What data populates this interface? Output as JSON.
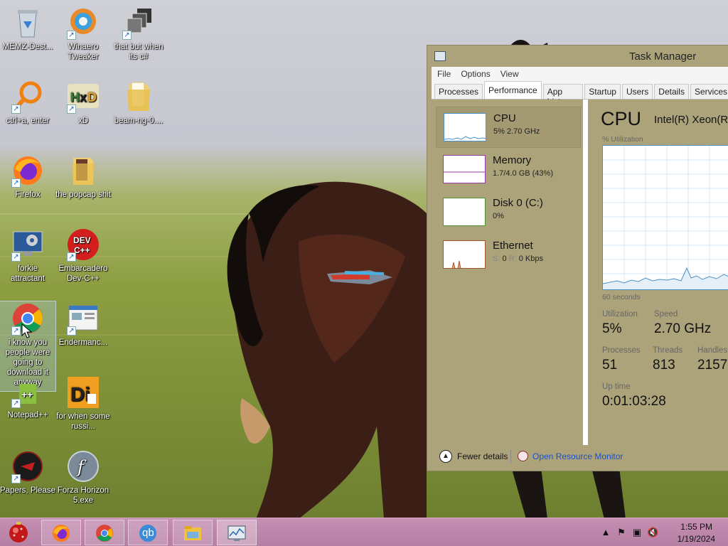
{
  "desktop": {
    "icons": [
      {
        "label": "MEMZ-Dest...",
        "icon": "recycle-bin-icon"
      },
      {
        "label": "Winaero Tweaker",
        "icon": "winaero-icon"
      },
      {
        "label": "that but when its c#",
        "icon": "stacked-windows-icon"
      },
      {
        "label": "ctrl+a, enter",
        "icon": "search-magnifier-icon"
      },
      {
        "label": "xD",
        "icon": "hxd-icon"
      },
      {
        "label": "beam-ng-0....",
        "icon": "folder-icon"
      },
      {
        "label": "Firefox",
        "icon": "firefox-icon"
      },
      {
        "label": "the popcap shit",
        "icon": "folder-icon"
      },
      {
        "label": "forkie attractant",
        "icon": "computer-gear-icon"
      },
      {
        "label": "Embarcadero Dev-C++",
        "icon": "devcpp-icon"
      },
      {
        "label": "i know you people were going to download it anyway",
        "icon": "chrome-icon"
      },
      {
        "label": "Endermanc...",
        "icon": "window-app-icon"
      },
      {
        "label": "Notepad++",
        "icon": "notepad-plus-icon"
      },
      {
        "label": "for when some russi...",
        "icon": "die-icon"
      },
      {
        "label": "Papers, Please",
        "icon": "papers-please-icon"
      },
      {
        "label": "Forza Horizon 5.exe",
        "icon": "flash-icon"
      }
    ]
  },
  "task_manager": {
    "title": "Task Manager",
    "menu": [
      "File",
      "Options",
      "View"
    ],
    "tabs": [
      "Processes",
      "Performance",
      "App history",
      "Startup",
      "Users",
      "Details",
      "Services"
    ],
    "active_tab": "Performance",
    "resources": [
      {
        "name": "CPU",
        "value": "5% 2.70 GHz",
        "color": "#4b90c5"
      },
      {
        "name": "Memory",
        "value": "1.7/4.0 GB (43%)",
        "color": "#9b3aa4"
      },
      {
        "name": "Disk 0 (C:)",
        "value": "0%",
        "color": "#4e9a2c"
      },
      {
        "name": "Ethernet",
        "value_send": "S:",
        "value_zero": "0",
        "value_recv": "R:",
        "value_rate": "0 Kbps",
        "color": "#a7582a"
      }
    ],
    "detail": {
      "heading": "CPU",
      "model": "Intel(R) Xeon(R)",
      "util_label": "% Utilization",
      "graph_span": "60 seconds",
      "utilization_label": "Utilization",
      "utilization": "5%",
      "speed_label": "Speed",
      "speed": "2.70 GHz",
      "processes_label": "Processes",
      "processes": "51",
      "threads_label": "Threads",
      "threads": "813",
      "handles_label": "Handles",
      "handles": "2157",
      "uptime_label": "Up time",
      "uptime": "0:01:03:28"
    },
    "footer": {
      "fewer_details": "Fewer details",
      "resource_monitor": "Open Resource Monitor"
    }
  },
  "taskbar": {
    "pinned": [
      "start-orb-icon",
      "firefox-icon",
      "chrome-icon",
      "qbittorrent-icon",
      "file-explorer-icon",
      "task-manager-icon"
    ],
    "qb_text": "qb",
    "clock_time": "1:55 PM",
    "clock_date": "1/19/2024"
  }
}
